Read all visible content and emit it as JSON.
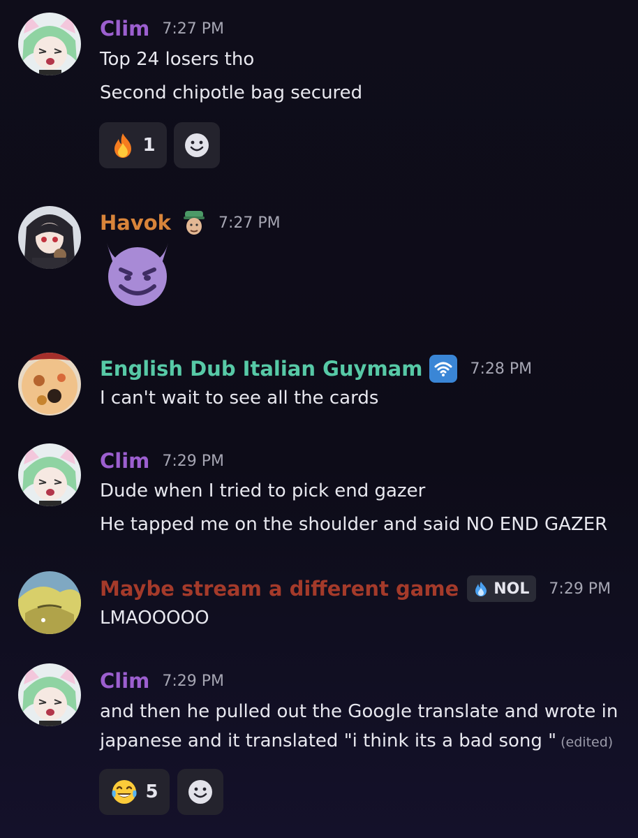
{
  "messages": [
    {
      "username": "Clim",
      "username_color": "#9c5fcf",
      "time": "7:27 PM",
      "lines": [
        "Top 24 losers tho",
        "Second chipotle bag secured"
      ],
      "reaction": {
        "emoji": "fire-icon",
        "count": "1"
      }
    },
    {
      "username": "Havok",
      "username_color": "#d8843a",
      "time": "7:27 PM",
      "emoji_message": "smiling-devil-icon"
    },
    {
      "username": "English Dub Italian Guymam",
      "username_color": "#57c9a6",
      "time": "7:28 PM",
      "badge": "wifi-icon",
      "lines": [
        "I can't wait to see all the cards"
      ]
    },
    {
      "username": "Clim",
      "username_color": "#9c5fcf",
      "time": "7:29 PM",
      "lines": [
        "Dude when I tried to pick end gazer",
        "He tapped me on the shoulder and said NO END GAZER"
      ]
    },
    {
      "username": "Maybe stream a different game",
      "username_color": "#a43a2a",
      "time": "7:29 PM",
      "tag": "NOL",
      "lines": [
        "LMAOOOOO"
      ]
    },
    {
      "username": "Clim",
      "username_color": "#9c5fcf",
      "time": "7:29 PM",
      "lines": [
        "and then he pulled out the Google translate and wrote in",
        "japanese and it translated \"i think its a bad song \""
      ],
      "edited": "(edited)",
      "reaction": {
        "emoji": "tears-of-joy-icon",
        "count": "5"
      }
    }
  ],
  "colors": {
    "background": "#0f0d1a",
    "reaction_bg": "#24232d",
    "timestamp": "#a6a6b3"
  }
}
